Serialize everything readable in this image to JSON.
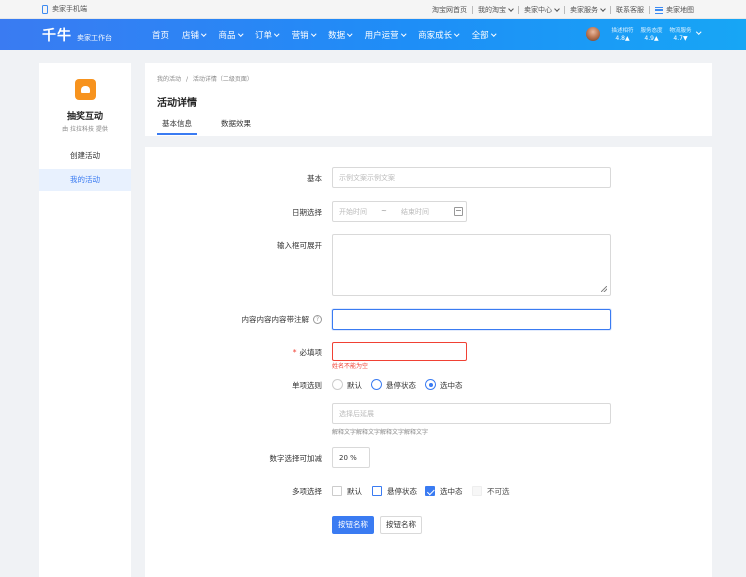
{
  "topbar": {
    "mobile_label": "卖家手机端",
    "links": [
      {
        "label": "淘宝网首页",
        "dropdown": false
      },
      {
        "label": "我的淘宝",
        "dropdown": true
      },
      {
        "label": "卖家中心",
        "dropdown": true
      },
      {
        "label": "卖家服务",
        "dropdown": true
      },
      {
        "label": "联系客服",
        "dropdown": false
      },
      {
        "label": "卖家地图",
        "dropdown": false
      }
    ]
  },
  "navbar": {
    "logo": "千牛",
    "subtitle": "卖家工作台",
    "items": [
      {
        "label": "首页",
        "dropdown": false
      },
      {
        "label": "店铺",
        "dropdown": true
      },
      {
        "label": "商品",
        "dropdown": true
      },
      {
        "label": "订单",
        "dropdown": true
      },
      {
        "label": "营销",
        "dropdown": true
      },
      {
        "label": "数据",
        "dropdown": true
      },
      {
        "label": "用户运营",
        "dropdown": true
      },
      {
        "label": "商家成长",
        "dropdown": true
      },
      {
        "label": "全部",
        "dropdown": true
      }
    ],
    "ratings": [
      {
        "label": "描述相符",
        "value": "4.8"
      },
      {
        "label": "服务态度",
        "value": "4.9"
      },
      {
        "label": "物流服务",
        "value": "4.7"
      }
    ]
  },
  "sidebar": {
    "app_title": "抽奖互动",
    "app_by": "由 拉拉科技 提供",
    "items": [
      {
        "label": "创建活动",
        "active": false
      },
      {
        "label": "我的活动",
        "active": true
      }
    ],
    "icon_color": "#f7931e"
  },
  "header": {
    "breadcrumb": [
      "我的活动",
      "活动详情（二级页面）"
    ],
    "breadcrumb_sep": "/",
    "title": "活动详情",
    "tabs": [
      {
        "label": "基本信息",
        "active": true
      },
      {
        "label": "数据效果",
        "active": false
      }
    ]
  },
  "form": {
    "basic": {
      "label": "基本",
      "placeholder": "示例文案示例文案"
    },
    "date": {
      "label": "日期选择",
      "start_placeholder": "开始时间",
      "sep": "~",
      "end_placeholder": "结束时间"
    },
    "textarea": {
      "label": "输入框可展开"
    },
    "annotated": {
      "label": "内容内容内容带注解",
      "help_icon": "?"
    },
    "required": {
      "label": "必填项",
      "marker": "*",
      "error": "姓名不能为空"
    },
    "radio": {
      "label": "单项选则",
      "options": [
        {
          "label": "默认",
          "state": "default"
        },
        {
          "label": "悬停状态",
          "state": "hover"
        },
        {
          "label": "选中态",
          "state": "checked"
        }
      ],
      "expand_placeholder": "选择后延展",
      "hint": "解释文字解释文字解释文字解释文字"
    },
    "number": {
      "label": "数字选择可加减",
      "value": "20 %"
    },
    "checkbox": {
      "label": "多项选择",
      "options": [
        {
          "label": "默认",
          "state": "default"
        },
        {
          "label": "悬停状态",
          "state": "hover"
        },
        {
          "label": "选中态",
          "state": "checked"
        },
        {
          "label": "不可选",
          "state": "disabled"
        }
      ]
    },
    "buttons": {
      "primary": "按钮名称",
      "secondary": "按钮名称"
    }
  },
  "colors": {
    "accent": "#3a7bf2",
    "error": "#f04134",
    "nav_gradient_start": "#3a7bf2",
    "nav_gradient_end": "#17a6f5"
  }
}
